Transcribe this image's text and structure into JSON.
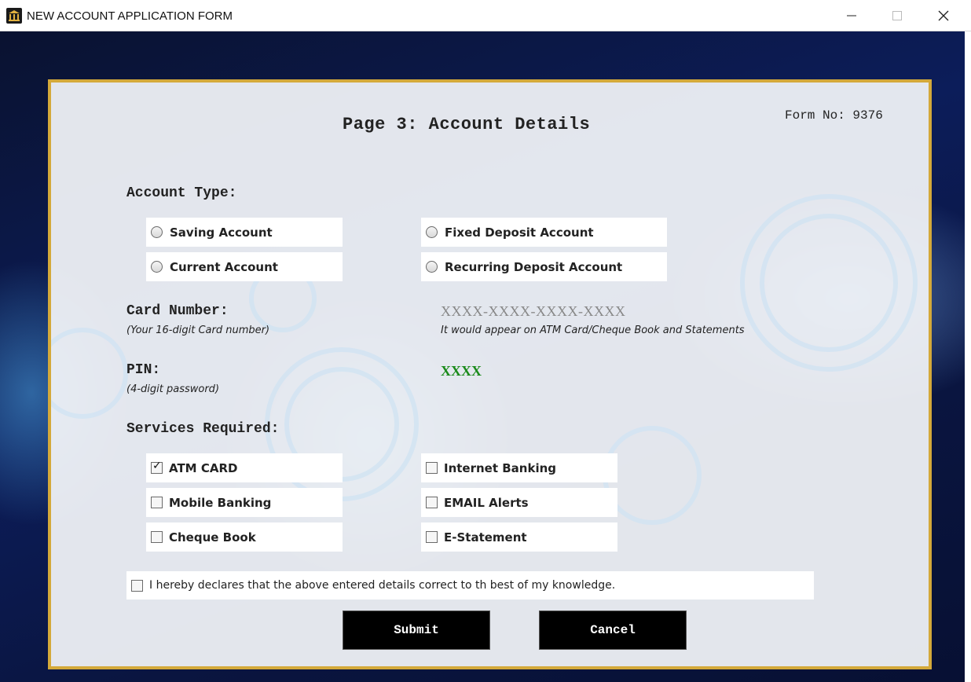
{
  "window": {
    "title": "NEW ACCOUNT APPLICATION FORM",
    "icon": "bank-icon",
    "controls": [
      "minimize-icon",
      "maximize-icon",
      "close-icon"
    ]
  },
  "form": {
    "page_title": "Page 3: Account Details",
    "form_no": "Form No: 9376"
  },
  "account_type": {
    "label": "Account Type:",
    "options": [
      {
        "label": "Saving Account",
        "selected": false
      },
      {
        "label": "Fixed Deposit Account",
        "selected": false
      },
      {
        "label": "Current Account",
        "selected": false
      },
      {
        "label": "Recurring Deposit Account",
        "selected": false
      }
    ]
  },
  "card": {
    "label": "Card Number:",
    "hint": "(Your 16-digit Card number)",
    "value": "XXXX-XXXX-XXXX-XXXX",
    "note": "It would appear on ATM Card/Cheque Book and Statements"
  },
  "pin": {
    "label": "PIN:",
    "hint": "(4-digit password)",
    "value": "XXXX"
  },
  "services": {
    "label": "Services Required:",
    "options": [
      {
        "label": "ATM CARD",
        "checked": true
      },
      {
        "label": "Internet Banking",
        "checked": false
      },
      {
        "label": "Mobile Banking",
        "checked": false
      },
      {
        "label": "EMAIL Alerts",
        "checked": false
      },
      {
        "label": "Cheque Book",
        "checked": false
      },
      {
        "label": "E-Statement",
        "checked": false
      }
    ]
  },
  "declaration": {
    "label": "I hereby declares that the above entered details correct to th best of my knowledge.",
    "checked": false
  },
  "buttons": {
    "submit": "Submit",
    "cancel": "Cancel"
  },
  "colors": {
    "panel_border": "#d4a93a",
    "button_bg": "#000000",
    "pin_text": "#1a8a1a",
    "card_text": "#888888"
  }
}
